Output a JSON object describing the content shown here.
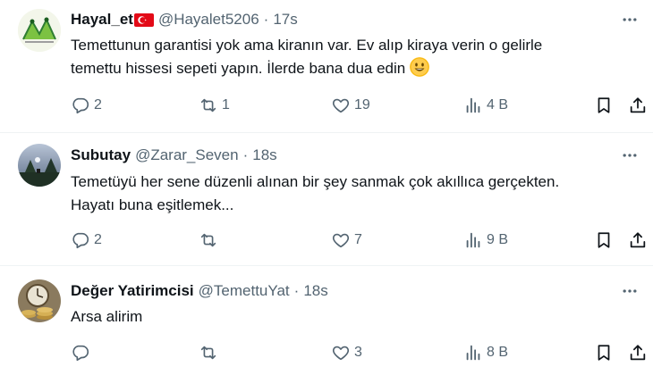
{
  "tweets": [
    {
      "name": "Hayal_et",
      "handle": "@Hayalet5206",
      "time": "17s",
      "line1": "Temettunun garantisi yok ama kiranın var. Ev alıp kiraya verin o gelirle",
      "line2": "temettu hissesi sepeti yapın. İlerde bana dua edin",
      "replies": "2",
      "reposts": "1",
      "likes": "19",
      "views": "4 B"
    },
    {
      "name": "Subutay",
      "handle": "@Zarar_Seven",
      "time": "18s",
      "line1": "Temetüyü her sene düzenli alınan bir şey sanmak çok akıllıca gerçekten.",
      "line2": "Hayatı buna eşitlemek...",
      "replies": "2",
      "reposts": "",
      "likes": "7",
      "views": "9 B"
    },
    {
      "name": "Değer Yatirimcisi",
      "handle": "@TemettuYat",
      "time": "18s",
      "line1": "Arsa alirim",
      "line2": "",
      "replies": "",
      "reposts": "",
      "likes": "3",
      "views": "8 B"
    }
  ],
  "separator": "·",
  "icons": {
    "reply": "reply-icon",
    "repost": "repost-icon",
    "like": "heart-icon",
    "views": "analytics-icon",
    "bookmark": "bookmark-icon",
    "share": "share-icon",
    "more": "more-icon",
    "flag": "turkey-flag-icon",
    "emoji": "smiley-emoji-icon"
  },
  "colors": {
    "text": "#0f1419",
    "secondary": "#536471",
    "divider": "#eff3f4",
    "flag_red": "#e30a17",
    "emoji_yellow": "#ffcc4d"
  }
}
